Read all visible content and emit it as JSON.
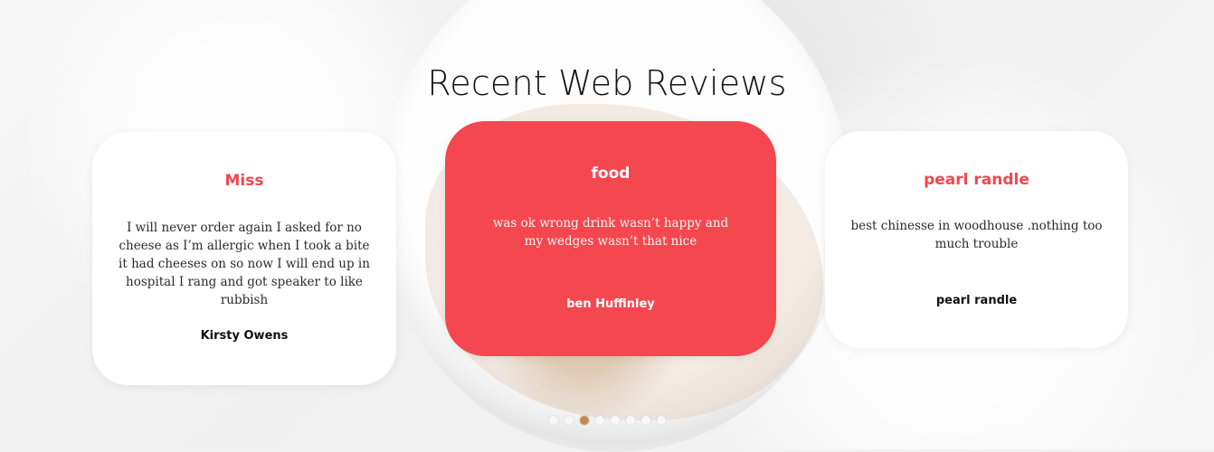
{
  "section": {
    "title": "Recent Web Reviews"
  },
  "reviews": [
    {
      "title": "Miss",
      "text": "I will never order again I asked for no cheese as I’m allergic when I took a bite it had cheeses on so now I will end up in hospital I rang and got speaker to like rubbish",
      "author": "Kirsty Owens"
    },
    {
      "title": "food",
      "text": "was ok wrong drink wasn’t happy and my wedges wasn’t that nice",
      "author": "ben Huffinley"
    },
    {
      "title": "pearl randle",
      "text": "best chinesse in woodhouse .nothing too much trouble",
      "author": "pearl randle"
    }
  ],
  "pagination": {
    "total": 8,
    "active_index": 2
  },
  "colors": {
    "accent_red": "#f5474f",
    "accent_text_red": "#f1474d",
    "active_dot": "#c58a4f"
  }
}
